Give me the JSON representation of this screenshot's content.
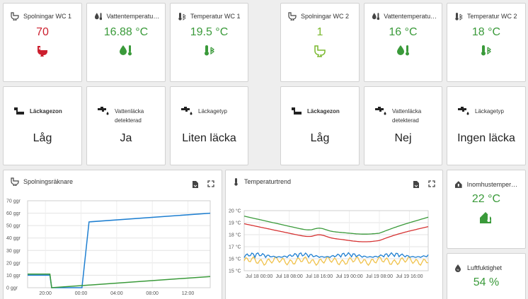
{
  "colors": {
    "red": "#cc1f2e",
    "green": "#3a9a3a",
    "lightgreen": "#7ab82e",
    "blue": "#1e7fd1",
    "yellow": "#f0c24b",
    "darkgreen": "#2e8b3e"
  },
  "wc1": {
    "flush": {
      "label": "Spolningar WC 1",
      "value": "70"
    },
    "watertemp": {
      "label": "Vattentemperatur …",
      "value": "16.88 °C"
    },
    "temp": {
      "label": "Temperatur WC 1",
      "value": "19.5 °C"
    }
  },
  "wc2": {
    "flush": {
      "label": "Spolningar WC 2",
      "value": "1"
    },
    "watertemp": {
      "label": "Vattentemperatur …",
      "value": "16 °C"
    },
    "temp": {
      "label": "Temperatur WC 2",
      "value": "18 °C"
    }
  },
  "leak1": {
    "zone": {
      "label": "Läckagezon",
      "value": "Låg"
    },
    "detected": {
      "label_line1": "Vattenläcka",
      "label_line2": "detekterad",
      "value": "Ja"
    },
    "type": {
      "label": "Läckagetyp",
      "value": "Liten läcka"
    }
  },
  "leak2": {
    "zone": {
      "label": "Läckagezon",
      "value": "Låg"
    },
    "detected": {
      "label_line1": "Vattenläcka",
      "label_line2": "detekterad",
      "value": "Nej"
    },
    "type": {
      "label": "Läckagetyp",
      "value": "Ingen läcka"
    }
  },
  "indoor": {
    "label": "Inomhustemperat…",
    "value": "22 °C"
  },
  "humidity": {
    "label": "Luftfuktighet",
    "value": "54 %"
  },
  "chart_data": [
    {
      "type": "line",
      "title": "Spolningsräknare",
      "y_ticks": [
        "70 ggr",
        "60 ggr",
        "50 ggr",
        "40 ggr",
        "30 ggr",
        "20 ggr",
        "10 ggr",
        "0 ggr"
      ],
      "ylim": [
        0,
        70
      ],
      "x_ticks": [
        "20:00",
        "00:00",
        "04:00",
        "08:00",
        "12:00"
      ],
      "x_range_hours": [
        18,
        38.5
      ],
      "x_tick_hours": [
        20,
        24,
        28,
        32,
        36
      ],
      "series": [
        {
          "color": "#1e7fd1",
          "x": [
            18,
            20.5,
            20.7,
            24.1,
            24.9,
            38.5
          ],
          "y": [
            10,
            10,
            0,
            0,
            53,
            60
          ]
        },
        {
          "color": "#3a9a3a",
          "x": [
            18,
            20.5,
            20.7,
            38.5
          ],
          "y": [
            11,
            11,
            0,
            9
          ]
        }
      ],
      "grid": true
    },
    {
      "type": "line",
      "title": "Temperaturtrend",
      "y_ticks": [
        "20 °C",
        "19 °C",
        "18 °C",
        "17 °C",
        "16 °C",
        "15 °C"
      ],
      "ylim": [
        15,
        20.5
      ],
      "x_ticks": [
        "Jul 18 00:00",
        "Jul 18 08:00",
        "Jul 18 16:00",
        "Jul 19 00:00",
        "Jul 19 08:00",
        "Jul 19 16:00"
      ],
      "x_range_hours": [
        -4,
        45
      ],
      "x_tick_hours": [
        0,
        8,
        16,
        24,
        32,
        40
      ],
      "grid": true
    }
  ]
}
